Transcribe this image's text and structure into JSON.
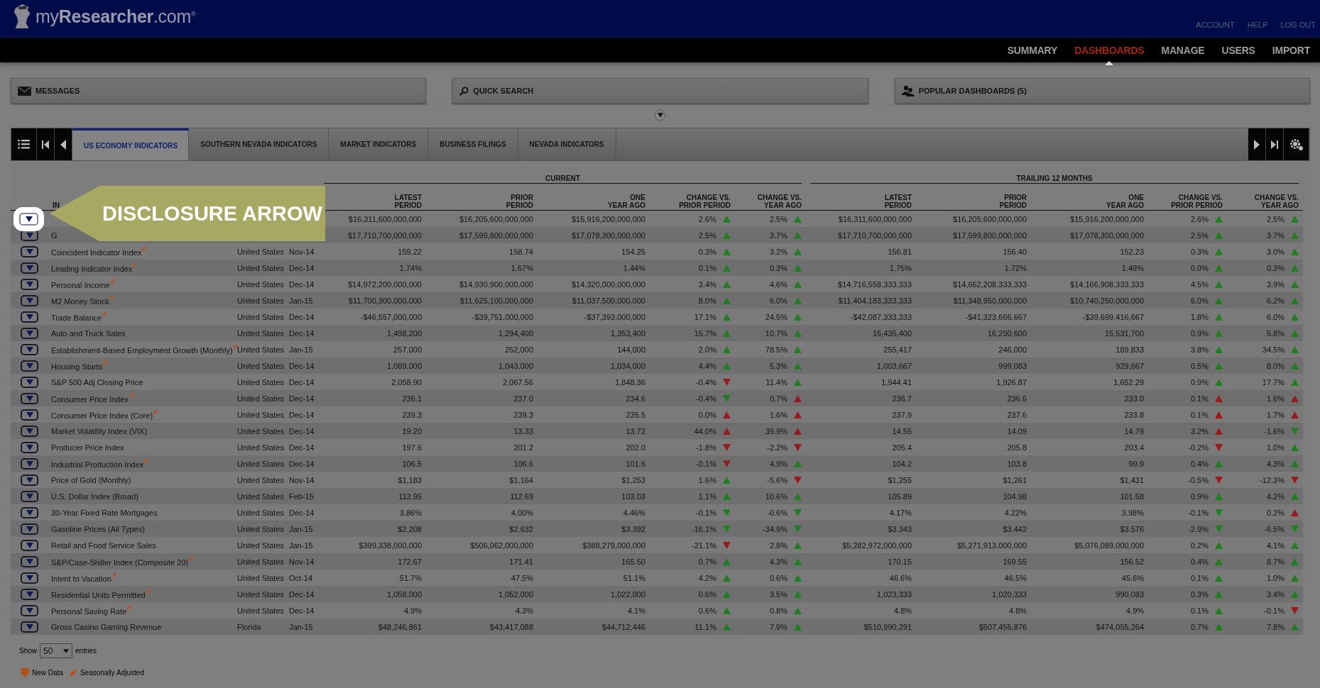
{
  "header": {
    "logo": "my**Researcher**.com$^{®}$",
    "links": [
      "ACCOUNT",
      "HELP",
      "LOG OUT"
    ]
  },
  "nav": [
    {
      "label": "SUMMARY",
      "selected": false
    },
    {
      "label": "DASHBOARDS",
      "selected": true
    },
    {
      "label": "MANAGE",
      "selected": false
    },
    {
      "label": "USERS",
      "selected": false
    },
    {
      "label": "IMPORT",
      "selected": false
    }
  ],
  "panels": [
    {
      "kind": "messages",
      "label": "MESSAGES"
    },
    {
      "kind": "search",
      "label": "QUICK SEARCH"
    },
    {
      "kind": "popular",
      "label": "POPULAR DASHBOARDS (5)"
    }
  ],
  "tabs": [
    {
      "label": "US ECONOMY INDICATORS",
      "selected": true
    },
    {
      "label": "SOUTHERN NEVADA INDICATORS",
      "selected": false
    },
    {
      "label": "MARKET INDICATORS",
      "selected": false
    },
    {
      "label": "BUSINESS FILINGS",
      "selected": false
    },
    {
      "label": "NEVADA INDICATORS",
      "selected": false
    }
  ],
  "table": {
    "groups": [
      "CURRENT",
      "TRAILING 12 MONTHS"
    ],
    "name_column": "IN",
    "columns": [
      "LATEST\nPERIOD",
      "PRIOR\nPERIOD",
      "ONE\nYEAR AGO",
      "CHANGE VS.\nPRIOR PERIOD",
      "CHANGE VS.\nYEAR AGO"
    ],
    "trailing_columns": [
      "LATEST\nPERIOD",
      "PRIOR\nPERIOD",
      "ONE\nYEAR AGO",
      "CHANGE VS.\nPRIOR PERIOD",
      "CHANGE VS.\nYEAR AGO"
    ],
    "rows": [
      {
        "highlighted": true,
        "current": [
          "$16,311,600,000,000",
          "$16,205,600,000,000",
          "$15,916,200,000,000"
        ],
        "current_changes": [
          {
            "text": "2.6%",
            "kind": "up",
            "color": "#1f7f1f"
          },
          {
            "text": "2.5%",
            "kind": "up",
            "color": "#1f7f1f"
          }
        ],
        "trailing": [
          "$16,311,600,000,000",
          "$16,205,600,000,000",
          "$15,916,200,000,000"
        ],
        "trailing_changes": [
          {
            "text": "2.6%",
            "kind": "up",
            "color": "#1f7f1f"
          },
          {
            "text": "2.5%",
            "kind": "up",
            "color": "#1f7f1f"
          }
        ]
      },
      {
        "highlighted": false,
        "name": "G",
        "current": [
          "$17,710,700,000,000",
          "$17,599,800,000,000",
          "$17,078,300,000,000"
        ],
        "current_changes": [
          {
            "text": "2.5%",
            "kind": "up",
            "color": "#1f7f1f"
          },
          {
            "text": "3.7%",
            "kind": "up",
            "color": "#1f7f1f"
          }
        ],
        "trailing": [
          "$17,710,700,000,000",
          "$17,599,800,000,000",
          "$17,078,300,000,000"
        ],
        "trailing_changes": [
          {
            "text": "2.5%",
            "kind": "up",
            "color": "#1f7f1f"
          },
          {
            "text": "3.7%",
            "kind": "up",
            "color": "#1f7f1f"
          }
        ]
      },
      {
        "highlighted": false,
        "name": "Coincident Indicator Index",
        "seasonally_adjusted": true,
        "country": "United States",
        "date": "Nov-14",
        "current": [
          "159.22",
          "158.74",
          "154.25"
        ],
        "current_changes": [
          {
            "text": "0.3%",
            "kind": "up",
            "color": "#1f7f1f"
          },
          {
            "text": "3.2%",
            "kind": "up",
            "color": "#1f7f1f"
          }
        ],
        "trailing": [
          "156.81",
          "156.40",
          "152.23"
        ],
        "trailing_changes": [
          {
            "text": "0.3%",
            "kind": "up",
            "color": "#1f7f1f"
          },
          {
            "text": "3.0%",
            "kind": "up",
            "color": "#1f7f1f"
          }
        ]
      },
      {
        "highlighted": false,
        "name": "Leading Indicator Index",
        "seasonally_adjusted": true,
        "country": "United States",
        "date": "Dec-14",
        "current": [
          "1.74%",
          "1.67%",
          "1.44%"
        ],
        "current_changes": [
          {
            "text": "0.1%",
            "kind": "up",
            "color": "#1f7f1f"
          },
          {
            "text": "0.3%",
            "kind": "up",
            "color": "#1f7f1f"
          }
        ],
        "trailing": [
          "1.75%",
          "1.72%",
          "1.49%"
        ],
        "trailing_changes": [
          {
            "text": "0.0%",
            "kind": "up",
            "color": "#1f7f1f"
          },
          {
            "text": "0.3%",
            "kind": "up",
            "color": "#1f7f1f"
          }
        ]
      },
      {
        "highlighted": false,
        "name": "Personal Income",
        "seasonally_adjusted": true,
        "country": "United States",
        "date": "Dec-14",
        "current": [
          "$14,972,200,000,000",
          "$14,930,900,000,000",
          "$14,320,000,000,000"
        ],
        "current_changes": [
          {
            "text": "3.4%",
            "kind": "up",
            "color": "#1f7f1f"
          },
          {
            "text": "4.6%",
            "kind": "up",
            "color": "#1f7f1f"
          }
        ],
        "trailing": [
          "$14,716,558,333,333",
          "$14,662,208,333,333",
          "$14,166,908,333,333"
        ],
        "trailing_changes": [
          {
            "text": "4.5%",
            "kind": "up",
            "color": "#1f7f1f"
          },
          {
            "text": "3.9%",
            "kind": "up",
            "color": "#1f7f1f"
          }
        ]
      },
      {
        "highlighted": false,
        "name": "M2 Money Stock",
        "seasonally_adjusted": true,
        "country": "United States",
        "date": "Jan-15",
        "current": [
          "$11,700,300,000,000",
          "$11,625,100,000,000",
          "$11,037,500,000,000"
        ],
        "current_changes": [
          {
            "text": "8.0%",
            "kind": "up",
            "color": "#1f7f1f"
          },
          {
            "text": "6.0%",
            "kind": "up",
            "color": "#1f7f1f"
          }
        ],
        "trailing": [
          "$11,404,183,333,333",
          "$11,348,950,000,000",
          "$10,740,250,000,000"
        ],
        "trailing_changes": [
          {
            "text": "6.0%",
            "kind": "up",
            "color": "#1f7f1f"
          },
          {
            "text": "6.2%",
            "kind": "up",
            "color": "#1f7f1f"
          }
        ]
      },
      {
        "highlighted": false,
        "name": "Trade Balance",
        "seasonally_adjusted": true,
        "country": "United States",
        "date": "Dec-14",
        "current": [
          "-$46,557,000,000",
          "-$39,751,000,000",
          "-$37,393,000,000"
        ],
        "current_changes": [
          {
            "text": "17.1%",
            "kind": "up",
            "color": "#1f7f1f"
          },
          {
            "text": "24.5%",
            "kind": "up",
            "color": "#1f7f1f"
          }
        ],
        "trailing": [
          "-$42,087,333,333",
          "-$41,323,666,667",
          "-$39,699,416,667"
        ],
        "trailing_changes": [
          {
            "text": "1.8%",
            "kind": "up",
            "color": "#1f7f1f"
          },
          {
            "text": "6.0%",
            "kind": "up",
            "color": "#1f7f1f"
          }
        ]
      },
      {
        "highlighted": false,
        "name": "Auto and Truck Sales",
        "seasonally_adjusted": false,
        "country": "United States",
        "date": "Dec-14",
        "current": [
          "1,498,200",
          "1,294,400",
          "1,353,400"
        ],
        "current_changes": [
          {
            "text": "15.7%",
            "kind": "up",
            "color": "#1f7f1f"
          },
          {
            "text": "10.7%",
            "kind": "up",
            "color": "#1f7f1f"
          }
        ],
        "trailing": [
          "16,435,400",
          "16,290,600",
          "15,531,700"
        ],
        "trailing_changes": [
          {
            "text": "0.9%",
            "kind": "up",
            "color": "#1f7f1f"
          },
          {
            "text": "5.8%",
            "kind": "up",
            "color": "#1f7f1f"
          }
        ]
      },
      {
        "highlighted": false,
        "name": "Establishment-Based Employment Growth (Monthly)",
        "seasonally_adjusted": true,
        "country": "United States",
        "date": "Jan-15",
        "current": [
          "257,000",
          "252,000",
          "144,000"
        ],
        "current_changes": [
          {
            "text": "2.0%",
            "kind": "up",
            "color": "#1f7f1f"
          },
          {
            "text": "78.5%",
            "kind": "up",
            "color": "#1f7f1f"
          }
        ],
        "trailing": [
          "255,417",
          "246,000",
          "189,833"
        ],
        "trailing_changes": [
          {
            "text": "3.8%",
            "kind": "up",
            "color": "#1f7f1f"
          },
          {
            "text": "34.5%",
            "kind": "up",
            "color": "#1f7f1f"
          }
        ]
      },
      {
        "highlighted": false,
        "name": "Housing Starts",
        "seasonally_adjusted": true,
        "country": "United States",
        "date": "Dec-14",
        "current": [
          "1,089,000",
          "1,043,000",
          "1,034,000"
        ],
        "current_changes": [
          {
            "text": "4.4%",
            "kind": "up",
            "color": "#1f7f1f"
          },
          {
            "text": "5.3%",
            "kind": "up",
            "color": "#1f7f1f"
          }
        ],
        "trailing": [
          "1,003,667",
          "999,083",
          "929,667"
        ],
        "trailing_changes": [
          {
            "text": "0.5%",
            "kind": "up",
            "color": "#1f7f1f"
          },
          {
            "text": "8.0%",
            "kind": "up",
            "color": "#1f7f1f"
          }
        ]
      },
      {
        "highlighted": false,
        "name": "S&P 500 Adj Closing Price",
        "seasonally_adjusted": false,
        "country": "United States",
        "date": "Dec-14",
        "current": [
          "2,058.90",
          "2,067.56",
          "1,848.36"
        ],
        "current_changes": [
          {
            "text": "-0.4%",
            "kind": "down",
            "color": "#9a1a1a"
          },
          {
            "text": "11.4%",
            "kind": "up",
            "color": "#1f7f1f"
          }
        ],
        "trailing": [
          "1,944.41",
          "1,926.87",
          "1,652.29"
        ],
        "trailing_changes": [
          {
            "text": "0.9%",
            "kind": "up",
            "color": "#1f7f1f"
          },
          {
            "text": "17.7%",
            "kind": "up",
            "color": "#1f7f1f"
          }
        ]
      },
      {
        "highlighted": false,
        "name": "Consumer Price Index",
        "seasonally_adjusted": true,
        "country": "United States",
        "date": "Dec-14",
        "current": [
          "236.1",
          "237.0",
          "234.6"
        ],
        "current_changes": [
          {
            "text": "-0.4%",
            "kind": "down",
            "color": "#1f7f1f"
          },
          {
            "text": "0.7%",
            "kind": "up",
            "color": "#9a1a1a"
          }
        ],
        "trailing": [
          "236.7",
          "236.6",
          "233.0"
        ],
        "trailing_changes": [
          {
            "text": "0.1%",
            "kind": "up",
            "color": "#9a1a1a"
          },
          {
            "text": "1.6%",
            "kind": "up",
            "color": "#9a1a1a"
          }
        ]
      },
      {
        "highlighted": false,
        "name": "Consumer Price Index (Core)",
        "seasonally_adjusted": true,
        "country": "United States",
        "date": "Dec-14",
        "current": [
          "239.3",
          "239.3",
          "235.5"
        ],
        "current_changes": [
          {
            "text": "0.0%",
            "kind": "up",
            "color": "#9a1a1a"
          },
          {
            "text": "1.6%",
            "kind": "up",
            "color": "#9a1a1a"
          }
        ],
        "trailing": [
          "237.9",
          "237.6",
          "233.8"
        ],
        "trailing_changes": [
          {
            "text": "0.1%",
            "kind": "up",
            "color": "#9a1a1a"
          },
          {
            "text": "1.7%",
            "kind": "up",
            "color": "#9a1a1a"
          }
        ]
      },
      {
        "highlighted": false,
        "name": "Market Volatility Index (VIX)",
        "seasonally_adjusted": false,
        "country": "United States",
        "date": "Dec-14",
        "current": [
          "19.20",
          "13.33",
          "13.72"
        ],
        "current_changes": [
          {
            "text": "44.0%",
            "kind": "up",
            "color": "#9a1a1a"
          },
          {
            "text": "39.9%",
            "kind": "up",
            "color": "#9a1a1a"
          }
        ],
        "trailing": [
          "14.55",
          "14.09",
          "14.79"
        ],
        "trailing_changes": [
          {
            "text": "3.2%",
            "kind": "up",
            "color": "#9a1a1a"
          },
          {
            "text": "-1.6%",
            "kind": "down",
            "color": "#1f7f1f"
          }
        ]
      },
      {
        "highlighted": false,
        "name": "Producer Price Index",
        "seasonally_adjusted": false,
        "country": "United States",
        "date": "Dec-14",
        "current": [
          "197.6",
          "201.2",
          "202.0"
        ],
        "current_changes": [
          {
            "text": "-1.8%",
            "kind": "down",
            "color": "#9a1a1a"
          },
          {
            "text": "-2.2%",
            "kind": "down",
            "color": "#9a1a1a"
          }
        ],
        "trailing": [
          "205.4",
          "205.8",
          "203.4"
        ],
        "trailing_changes": [
          {
            "text": "-0.2%",
            "kind": "down",
            "color": "#9a1a1a"
          },
          {
            "text": "1.0%",
            "kind": "up",
            "color": "#1f7f1f"
          }
        ]
      },
      {
        "highlighted": false,
        "name": "Industrial Production Index",
        "seasonally_adjusted": true,
        "country": "United States",
        "date": "Dec-14",
        "current": [
          "106.5",
          "106.6",
          "101.6"
        ],
        "current_changes": [
          {
            "text": "-0.1%",
            "kind": "down",
            "color": "#9a1a1a"
          },
          {
            "text": "4.9%",
            "kind": "up",
            "color": "#1f7f1f"
          }
        ],
        "trailing": [
          "104.2",
          "103.8",
          "99.9"
        ],
        "trailing_changes": [
          {
            "text": "0.4%",
            "kind": "up",
            "color": "#1f7f1f"
          },
          {
            "text": "4.3%",
            "kind": "up",
            "color": "#1f7f1f"
          }
        ]
      },
      {
        "highlighted": false,
        "name": "Price of Gold (Monthly)",
        "seasonally_adjusted": false,
        "country": "United States",
        "date": "Nov-14",
        "current": [
          "$1,183",
          "$1,164",
          "$1,253"
        ],
        "current_changes": [
          {
            "text": "1.6%",
            "kind": "up",
            "color": "#1f7f1f"
          },
          {
            "text": "-5.6%",
            "kind": "down",
            "color": "#9a1a1a"
          }
        ],
        "trailing": [
          "$1,255",
          "$1,261",
          "$1,431"
        ],
        "trailing_changes": [
          {
            "text": "-0.5%",
            "kind": "down",
            "color": "#9a1a1a"
          },
          {
            "text": "-12.3%",
            "kind": "down",
            "color": "#9a1a1a"
          }
        ]
      },
      {
        "highlighted": false,
        "name": "U.S. Dollar Index (Broad)",
        "seasonally_adjusted": false,
        "country": "United States",
        "date": "Feb-15",
        "current": [
          "113.95",
          "112.69",
          "103.03"
        ],
        "current_changes": [
          {
            "text": "1.1%",
            "kind": "up",
            "color": "#1f7f1f"
          },
          {
            "text": "10.6%",
            "kind": "up",
            "color": "#1f7f1f"
          }
        ],
        "trailing": [
          "105.89",
          "104.98",
          "101.58"
        ],
        "trailing_changes": [
          {
            "text": "0.9%",
            "kind": "up",
            "color": "#1f7f1f"
          },
          {
            "text": "4.2%",
            "kind": "up",
            "color": "#1f7f1f"
          }
        ]
      },
      {
        "highlighted": false,
        "name": "30-Year Fixed Rate Mortgages",
        "seasonally_adjusted": false,
        "country": "United States",
        "date": "Dec-14",
        "current": [
          "3.86%",
          "4.00%",
          "4.46%"
        ],
        "current_changes": [
          {
            "text": "-0.1%",
            "kind": "down",
            "color": "#1f7f1f"
          },
          {
            "text": "-0.6%",
            "kind": "down",
            "color": "#1f7f1f"
          }
        ],
        "trailing": [
          "4.17%",
          "4.22%",
          "3.98%"
        ],
        "trailing_changes": [
          {
            "text": "-0.1%",
            "kind": "down",
            "color": "#1f7f1f"
          },
          {
            "text": "0.2%",
            "kind": "up",
            "color": "#9a1a1a"
          }
        ]
      },
      {
        "highlighted": false,
        "name": "Gasoline Prices (All Types)",
        "seasonally_adjusted": false,
        "country": "United States",
        "date": "Jan-15",
        "current": [
          "$2.208",
          "$2.632",
          "$3.392"
        ],
        "current_changes": [
          {
            "text": "-16.1%",
            "kind": "down",
            "color": "#1f7f1f"
          },
          {
            "text": "-34.9%",
            "kind": "down",
            "color": "#1f7f1f"
          }
        ],
        "trailing": [
          "$3.343",
          "$3.442",
          "$3.576"
        ],
        "trailing_changes": [
          {
            "text": "-2.9%",
            "kind": "down",
            "color": "#1f7f1f"
          },
          {
            "text": "-6.5%",
            "kind": "down",
            "color": "#1f7f1f"
          }
        ]
      },
      {
        "highlighted": false,
        "name": "Retail and Food Service Sales",
        "seasonally_adjusted": false,
        "country": "United States",
        "date": "Jan-15",
        "current": [
          "$399,338,000,000",
          "$506,062,000,000",
          "$388,279,000,000"
        ],
        "current_changes": [
          {
            "text": "-21.1%",
            "kind": "down",
            "color": "#9a1a1a"
          },
          {
            "text": "2.8%",
            "kind": "up",
            "color": "#1f7f1f"
          }
        ],
        "trailing": [
          "$5,282,972,000,000",
          "$5,271,913,000,000",
          "$5,076,089,000,000"
        ],
        "trailing_changes": [
          {
            "text": "0.2%",
            "kind": "up",
            "color": "#1f7f1f"
          },
          {
            "text": "4.1%",
            "kind": "up",
            "color": "#1f7f1f"
          }
        ]
      },
      {
        "highlighted": false,
        "name": "S&P/Case-Shiller Index (Composite 20)",
        "seasonally_adjusted": true,
        "country": "United States",
        "date": "Nov-14",
        "current": [
          "172.67",
          "171.41",
          "165.50"
        ],
        "current_changes": [
          {
            "text": "0.7%",
            "kind": "up",
            "color": "#1f7f1f"
          },
          {
            "text": "4.3%",
            "kind": "up",
            "color": "#1f7f1f"
          }
        ],
        "trailing": [
          "170.15",
          "169.55",
          "156.52"
        ],
        "trailing_changes": [
          {
            "text": "0.4%",
            "kind": "up",
            "color": "#1f7f1f"
          },
          {
            "text": "8.7%",
            "kind": "up",
            "color": "#1f7f1f"
          }
        ]
      },
      {
        "highlighted": false,
        "name": "Intent to Vacation",
        "seasonally_adjusted": true,
        "country": "United States",
        "date": "Oct-14",
        "current": [
          "51.7%",
          "47.5%",
          "51.1%"
        ],
        "current_changes": [
          {
            "text": "4.2%",
            "kind": "up",
            "color": "#1f7f1f"
          },
          {
            "text": "0.6%",
            "kind": "up",
            "color": "#1f7f1f"
          }
        ],
        "trailing": [
          "46.6%",
          "46.5%",
          "45.6%"
        ],
        "trailing_changes": [
          {
            "text": "0.1%",
            "kind": "up",
            "color": "#1f7f1f"
          },
          {
            "text": "1.0%",
            "kind": "up",
            "color": "#1f7f1f"
          }
        ]
      },
      {
        "highlighted": false,
        "name": "Residential Units Permitted",
        "seasonally_adjusted": true,
        "country": "United States",
        "date": "Dec-14",
        "current": [
          "1,058,000",
          "1,052,000",
          "1,022,000"
        ],
        "current_changes": [
          {
            "text": "0.6%",
            "kind": "up",
            "color": "#1f7f1f"
          },
          {
            "text": "3.5%",
            "kind": "up",
            "color": "#1f7f1f"
          }
        ],
        "trailing": [
          "1,023,333",
          "1,020,333",
          "990,083"
        ],
        "trailing_changes": [
          {
            "text": "0.3%",
            "kind": "up",
            "color": "#1f7f1f"
          },
          {
            "text": "3.4%",
            "kind": "up",
            "color": "#1f7f1f"
          }
        ]
      },
      {
        "highlighted": false,
        "name": "Personal Saving Rate",
        "seasonally_adjusted": true,
        "country": "United States",
        "date": "Dec-14",
        "current": [
          "4.9%",
          "4.3%",
          "4.1%"
        ],
        "current_changes": [
          {
            "text": "0.6%",
            "kind": "up",
            "color": "#1f7f1f"
          },
          {
            "text": "0.8%",
            "kind": "up",
            "color": "#1f7f1f"
          }
        ],
        "trailing": [
          "4.8%",
          "4.8%",
          "4.9%"
        ],
        "trailing_changes": [
          {
            "text": "0.1%",
            "kind": "up",
            "color": "#1f7f1f"
          },
          {
            "text": "-0.1%",
            "kind": "down",
            "color": "#9a1a1a"
          }
        ]
      },
      {
        "highlighted": false,
        "name": "Gross Casino Gaming Revenue",
        "seasonally_adjusted": false,
        "country": "Florida",
        "date": "Jan-15",
        "current": [
          "$48,246,861",
          "$43,417,088",
          "$44,712,446"
        ],
        "current_changes": [
          {
            "text": "11.1%",
            "kind": "up",
            "color": "#1f7f1f"
          },
          {
            "text": "7.9%",
            "kind": "up",
            "color": "#1f7f1f"
          }
        ],
        "trailing": [
          "$510,990,291",
          "$507,455,876",
          "$474,055,264"
        ],
        "trailing_changes": [
          {
            "text": "0.7%",
            "kind": "up",
            "color": "#1f7f1f"
          },
          {
            "text": "7.8%",
            "kind": "up",
            "color": "#1f7f1f"
          }
        ]
      }
    ]
  },
  "entries": {
    "before": "Show",
    "value": "50",
    "after": "entries"
  },
  "legend": [
    {
      "kind": "new",
      "label": "New Data"
    },
    {
      "kind": "seasonal",
      "label": "Seasonally Adjusted"
    }
  ],
  "callout": {
    "text": "DISCLOSURE ARROW"
  }
}
